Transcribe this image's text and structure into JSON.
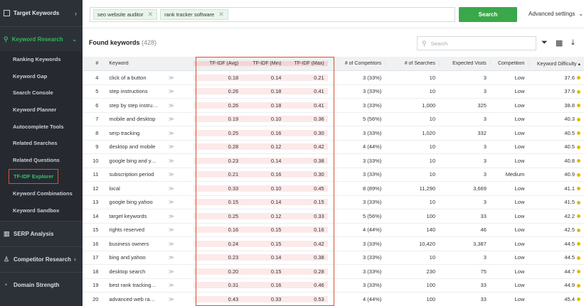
{
  "sidebar": {
    "top_label": "Target Keywords",
    "section_label": "Keyword Research",
    "items": [
      {
        "label": "Ranking Keywords"
      },
      {
        "label": "Keyword Gap"
      },
      {
        "label": "Search Console"
      },
      {
        "label": "Keyword Planner"
      },
      {
        "label": "Autocomplete Tools"
      },
      {
        "label": "Related Searches"
      },
      {
        "label": "Related Questions"
      },
      {
        "label": "TF-IDF Explorer"
      },
      {
        "label": "Keyword Combinations"
      },
      {
        "label": "Keyword Sandbox"
      }
    ],
    "groups": [
      {
        "label": "SERP Analysis"
      },
      {
        "label": "Competitor Research"
      },
      {
        "label": "Domain Strength"
      }
    ]
  },
  "topbar": {
    "tags": [
      "seo website auditor",
      "rank tracker software"
    ],
    "search_button": "Search",
    "advanced": "Advanced settings"
  },
  "found": {
    "label": "Found keywords",
    "count": "(428)"
  },
  "table_search": {
    "placeholder": "Search"
  },
  "columns": {
    "num": "#",
    "keyword": "Keyword",
    "tfidf_avg": "TF-IDF (Avg)",
    "tfidf_min": "TF-IDF (Min)",
    "tfidf_max": "TF-IDF (Max)",
    "competitors": "# of Competitors",
    "searches": "# of Searches",
    "visits": "Expected Visits",
    "competition": "Competition",
    "difficulty": "Keyword Difficulty"
  },
  "rows": [
    {
      "n": "4",
      "kw": "click of a button",
      "avg": "0.18",
      "min": "0.14",
      "max": "0.21",
      "comp": "3 (33%)",
      "srch": "10",
      "vis": "3",
      "cmp": "Low",
      "kd": "37.6"
    },
    {
      "n": "5",
      "kw": "step instructions",
      "avg": "0.26",
      "min": "0.18",
      "max": "0.41",
      "comp": "3 (33%)",
      "srch": "10",
      "vis": "3",
      "cmp": "Low",
      "kd": "37.9"
    },
    {
      "n": "6",
      "kw": "step by step instruct...",
      "avg": "0.26",
      "min": "0.18",
      "max": "0.41",
      "comp": "3 (33%)",
      "srch": "1,000",
      "vis": "325",
      "cmp": "Low",
      "kd": "38.8"
    },
    {
      "n": "7",
      "kw": "mobile and desktop",
      "avg": "0.19",
      "min": "0.10",
      "max": "0.36",
      "comp": "5 (56%)",
      "srch": "10",
      "vis": "3",
      "cmp": "Low",
      "kd": "40.3"
    },
    {
      "n": "8",
      "kw": "serp tracking",
      "avg": "0.25",
      "min": "0.16",
      "max": "0.30",
      "comp": "3 (33%)",
      "srch": "1,020",
      "vis": "332",
      "cmp": "Low",
      "kd": "40.5"
    },
    {
      "n": "9",
      "kw": "desktop and mobile",
      "avg": "0.28",
      "min": "0.12",
      "max": "0.42",
      "comp": "4 (44%)",
      "srch": "10",
      "vis": "3",
      "cmp": "Low",
      "kd": "40.5"
    },
    {
      "n": "10",
      "kw": "google bing and yah...",
      "avg": "0.23",
      "min": "0.14",
      "max": "0.38",
      "comp": "3 (33%)",
      "srch": "10",
      "vis": "3",
      "cmp": "Low",
      "kd": "40.8"
    },
    {
      "n": "11",
      "kw": "subscription period",
      "avg": "0.21",
      "min": "0.16",
      "max": "0.30",
      "comp": "3 (33%)",
      "srch": "10",
      "vis": "3",
      "cmp": "Medium",
      "kd": "40.9"
    },
    {
      "n": "12",
      "kw": "local",
      "avg": "0.33",
      "min": "0.10",
      "max": "0.45",
      "comp": "8 (89%)",
      "srch": "11,290",
      "vis": "3,669",
      "cmp": "Low",
      "kd": "41.1"
    },
    {
      "n": "13",
      "kw": "google bing yahoo",
      "avg": "0.15",
      "min": "0.14",
      "max": "0.15",
      "comp": "3 (33%)",
      "srch": "10",
      "vis": "3",
      "cmp": "Low",
      "kd": "41.5"
    },
    {
      "n": "14",
      "kw": "target keywords",
      "avg": "0.25",
      "min": "0.12",
      "max": "0.33",
      "comp": "5 (56%)",
      "srch": "100",
      "vis": "33",
      "cmp": "Low",
      "kd": "42.2"
    },
    {
      "n": "15",
      "kw": "rights reserved",
      "avg": "0.16",
      "min": "0.15",
      "max": "0.16",
      "comp": "4 (44%)",
      "srch": "140",
      "vis": "46",
      "cmp": "Low",
      "kd": "42.5"
    },
    {
      "n": "16",
      "kw": "business owners",
      "avg": "0.24",
      "min": "0.15",
      "max": "0.42",
      "comp": "3 (33%)",
      "srch": "10,420",
      "vis": "3,387",
      "cmp": "Low",
      "kd": "44.5"
    },
    {
      "n": "17",
      "kw": "bing and yahoo",
      "avg": "0.23",
      "min": "0.14",
      "max": "0.38",
      "comp": "3 (33%)",
      "srch": "10",
      "vis": "3",
      "cmp": "Low",
      "kd": "44.5"
    },
    {
      "n": "18",
      "kw": "desktop search",
      "avg": "0.20",
      "min": "0.15",
      "max": "0.28",
      "comp": "3 (33%)",
      "srch": "230",
      "vis": "75",
      "cmp": "Low",
      "kd": "44.7"
    },
    {
      "n": "19",
      "kw": "best rank tracking s...",
      "avg": "0.31",
      "min": "0.16",
      "max": "0.46",
      "comp": "3 (33%)",
      "srch": "100",
      "vis": "33",
      "cmp": "Low",
      "kd": "44.9"
    },
    {
      "n": "20",
      "kw": "advanced web ranki...",
      "avg": "0.43",
      "min": "0.33",
      "max": "0.53",
      "comp": "4 (44%)",
      "srch": "100",
      "vis": "33",
      "cmp": "Low",
      "kd": "45.4"
    }
  ],
  "colors": {
    "accent": "#3aa84a",
    "sidebar_bg": "#2c3138",
    "highlight": "#fce9e9",
    "selection_border": "#d9502d",
    "dot": "#e6b800"
  }
}
